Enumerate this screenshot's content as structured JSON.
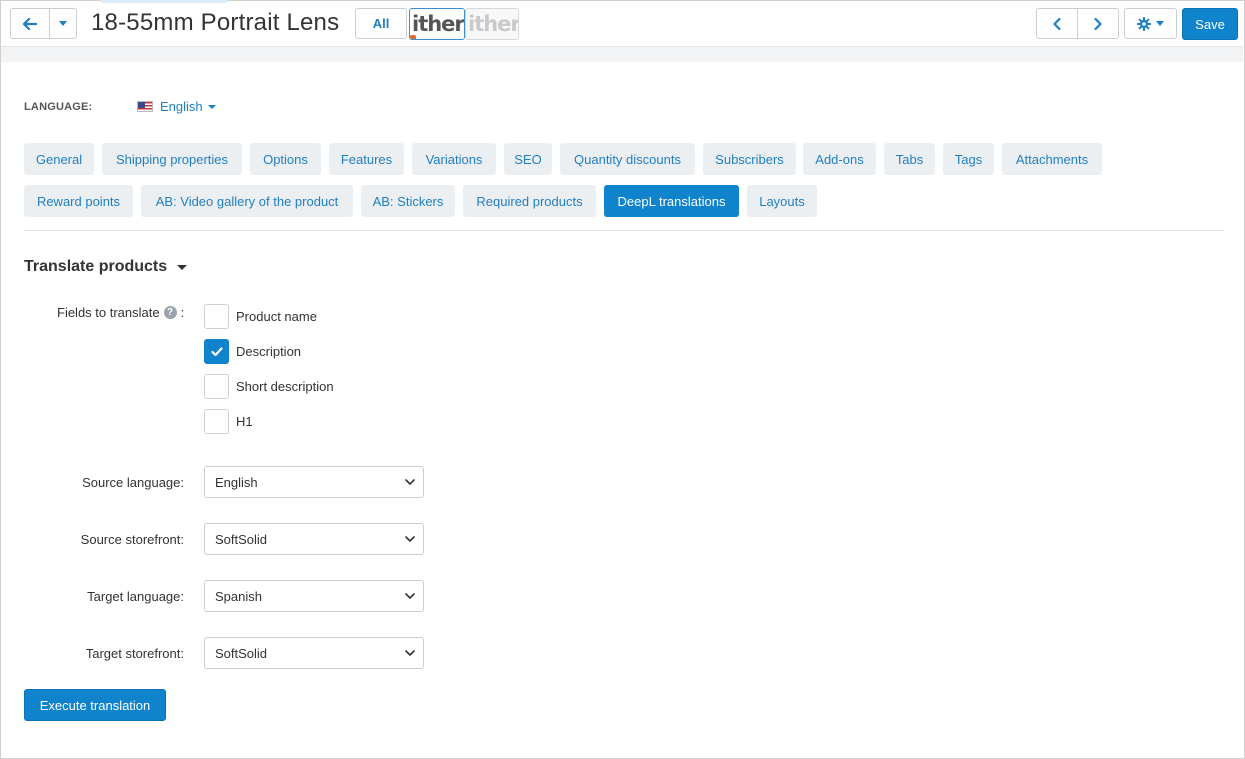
{
  "header": {
    "title": "18-55mm Portrait Lens",
    "all_label": "All",
    "logo_text": "ither",
    "save_label": "Save"
  },
  "language": {
    "label": "LANGUAGE:",
    "value": "English"
  },
  "tabs": [
    {
      "label": "General"
    },
    {
      "label": "Shipping properties"
    },
    {
      "label": "Options"
    },
    {
      "label": "Features"
    },
    {
      "label": "Variations"
    },
    {
      "label": "SEO"
    },
    {
      "label": "Quantity discounts"
    },
    {
      "label": "Subscribers"
    },
    {
      "label": "Add-ons"
    },
    {
      "label": "Tabs"
    },
    {
      "label": "Tags"
    },
    {
      "label": "Attachments"
    },
    {
      "label": "Reward points"
    },
    {
      "label": "AB: Video gallery of the product"
    },
    {
      "label": "AB: Stickers"
    },
    {
      "label": "Required products"
    },
    {
      "label": "DeepL translations",
      "active": true
    },
    {
      "label": "Layouts"
    }
  ],
  "section": {
    "title": "Translate products",
    "fields_label": "Fields to translate",
    "fields": [
      {
        "label": "Product name",
        "checked": false
      },
      {
        "label": "Description",
        "checked": true
      },
      {
        "label": "Short description",
        "checked": false
      },
      {
        "label": "H1",
        "checked": false
      }
    ],
    "source_language_label": "Source language:",
    "source_language": "English",
    "source_storefront_label": "Source storefront:",
    "source_storefront": "SoftSolid",
    "target_language_label": "Target language:",
    "target_language": "Spanish",
    "target_storefront_label": "Target storefront:",
    "target_storefront": "SoftSolid",
    "execute_label": "Execute translation"
  },
  "colors": {
    "accent": "#0f83cc",
    "link": "#1f7fc4",
    "tab_bg": "#eceff2"
  }
}
